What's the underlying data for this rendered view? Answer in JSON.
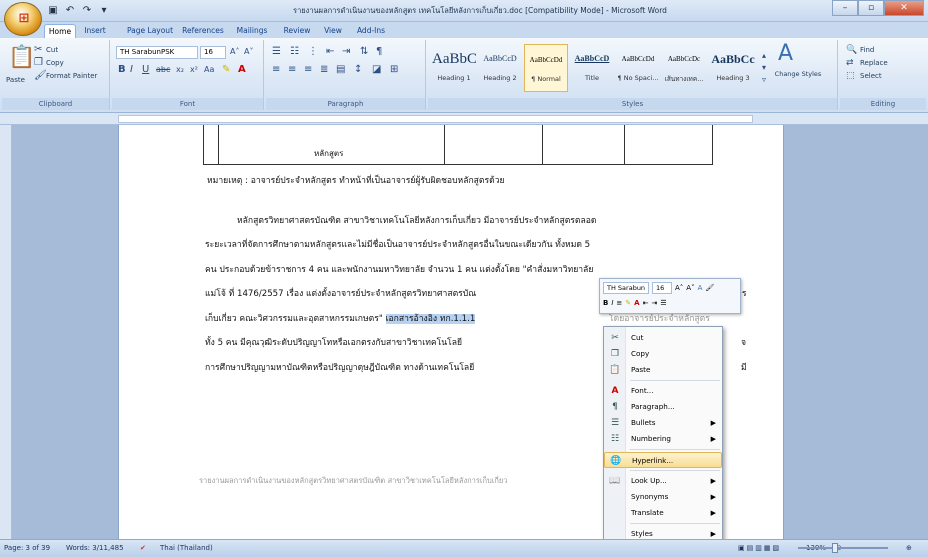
{
  "window": {
    "title": "รายงานผลการดำเนินงานของหลักสูตร เทคโนโลยีหลังการเก็บเกี่ยว.doc [Compatibility Mode] - Microsoft Word"
  },
  "qat": [
    "save-icon",
    "undo-icon",
    "redo-icon"
  ],
  "tabs": [
    "Home",
    "Insert",
    "Page Layout",
    "References",
    "Mailings",
    "Review",
    "View",
    "Add-Ins"
  ],
  "ribbon": {
    "clipboard": {
      "paste": "Paste",
      "cut": "Cut",
      "copy": "Copy",
      "format_painter": "Format Painter",
      "label": "Clipboard"
    },
    "font": {
      "name": "TH SarabunPSK",
      "size": "16",
      "label": "Font"
    },
    "paragraph": {
      "label": "Paragraph"
    },
    "styles": {
      "items": [
        {
          "sample": "AaBbC",
          "name": "Heading 1"
        },
        {
          "sample": "AaBbCcD",
          "name": "Heading 2"
        },
        {
          "sample": "AaBbCcDd",
          "name": "¶ Normal"
        },
        {
          "sample": "AaBbCcD",
          "name": "Title"
        },
        {
          "sample": "AaBbCcDd",
          "name": "¶ No Spaci..."
        },
        {
          "sample": "AaBbCcDc",
          "name": "เส้นทางเทค..."
        },
        {
          "sample": "AaBbCc",
          "name": "Heading 3"
        }
      ],
      "change_styles": "Change Styles",
      "label": "Styles"
    },
    "editing": {
      "find": "Find",
      "replace": "Replace",
      "select": "Select",
      "label": "Editing"
    }
  },
  "document": {
    "table_cell": "หลักสูตร",
    "note": "หมายเหตุ : อาจารย์ประจำหลักสูตร ทำหน้าที่เป็นอาจารย์ผู้รับผิดชอบหลักสูตรด้วย",
    "lines": [
      "หลักสูตรวิทยาศาสตรบัณฑิต สาขาวิชาเทคโนโลยีหลังการเก็บเกี่ยว มีอาจารย์ประจำหลักสูตรตลอด",
      "ระยะเวลาที่จัดการศึกษาตามหลักสูตรและไม่มีชื่อเป็นอาจารย์ประจำหลักสูตรอื่นในขณะเดียวกัน ทั้งหมด 5",
      "คน ประกอบด้วยข้าราชการ 4 คน และพนักงานมหาวิทยาลัย จำนวน 1 คน แต่งตั้งโดย \"คำสั่งมหาวิทยาลัย",
      "แม่โจ้ ที่ 1476/2557 เรื่อง แต่งตั้งอาจารย์ประจำหลักสูตรวิทยาศาสตรบัณ",
      "เก็บเกี่ยว คณะวิศวกรรมและอุตสาหกรรมเกษตร\" ",
      "ทั้ง 5 คน มีคุณวุฒิระดับปริญญาโทหรือเอกตรงกับสาขาวิชาเทคโนโลยี",
      "การศึกษาปริญญามหาบัณฑิตหรือปริญญาดุษฎีบัณฑิต ทางด้านเทคโนโลยี"
    ],
    "selected": "เอกสารอ้างอิง ทก.1.1.1",
    "line4_tail": "าร",
    "line5_tail": "โดยอาจารย์ประจำหลักสูตร",
    "line6_tail": "จ",
    "line7_tail": "มี",
    "footer": "รายงานผลการดำเนินงานของหลักสูตรวิทยาศาสตรบัณฑิต สาขาวิชาเทคโนโลยีหลังการเก็บเกี่ยว"
  },
  "mini_toolbar": {
    "font": "TH Sarabun",
    "size": "16"
  },
  "context_menu": [
    {
      "label": "Cut",
      "icon": "scissors-icon"
    },
    {
      "label": "Copy",
      "icon": "copy-icon"
    },
    {
      "label": "Paste",
      "icon": "paste-icon"
    },
    {
      "label": "Font...",
      "icon": "font-icon"
    },
    {
      "label": "Paragraph...",
      "icon": "paragraph-icon"
    },
    {
      "label": "Bullets",
      "icon": "bullets-icon",
      "submenu": true
    },
    {
      "label": "Numbering",
      "icon": "numbering-icon",
      "submenu": true
    },
    {
      "label": "Hyperlink...",
      "icon": "hyperlink-icon",
      "highlighted": true
    },
    {
      "label": "Look Up...",
      "icon": "lookup-icon",
      "submenu": true
    },
    {
      "label": "Synonyms",
      "icon": "",
      "submenu": true
    },
    {
      "label": "Translate",
      "icon": "",
      "submenu": true
    },
    {
      "label": "Styles",
      "icon": "",
      "submenu": true
    }
  ],
  "status": {
    "page": "Page: 3 of 39",
    "words": "Words: 3/11,485",
    "language": "Thai (Thailand)",
    "zoom": "130%"
  }
}
